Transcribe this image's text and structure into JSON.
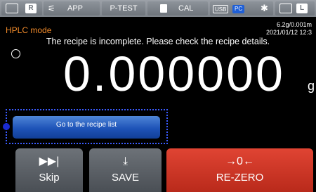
{
  "topbar": {
    "r_label": "R",
    "app_label": "APP",
    "ptest_label": "P-TEST",
    "cal_label": "CAL",
    "usb_label": "USB",
    "pc_label": "PC",
    "l_label": "L"
  },
  "header": {
    "mode": "HPLC mode",
    "resolution": "6.2g/0.001m",
    "datetime": "2021/01/12  12:3"
  },
  "message": "The recipe is incomplete. Please check the recipe details.",
  "display": {
    "weight": "0.000000",
    "unit": "g"
  },
  "recipe_button": {
    "label": "Go to the recipe list"
  },
  "bottom": {
    "skip_label": "Skip",
    "save_label": "SAVE",
    "rezero_label": "RE-ZERO",
    "rezero_icon_text": "→0←"
  },
  "colors": {
    "mode_orange": "#f08a2a",
    "recipe_blue": "#1e53b8",
    "rezero_red": "#d23a2a",
    "focus_blue": "#3a5bff"
  }
}
